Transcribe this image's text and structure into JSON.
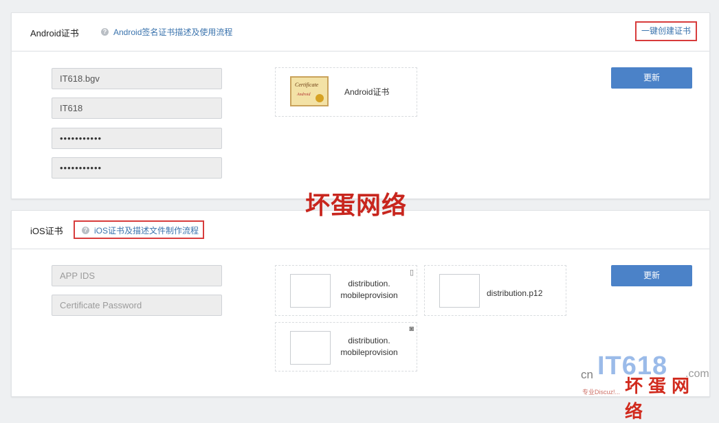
{
  "android": {
    "title": "Android证书",
    "help_link": "Android签名证书描述及使用流程",
    "create_link": "一键创建证书",
    "fields": [
      "IT618.bgv",
      "IT618",
      "•••••••••••",
      "•••••••••••"
    ],
    "cert_label": "Android证书",
    "update": "更新"
  },
  "ios": {
    "title": "iOS证书",
    "help_link": "iOS证书及描述文件制作流程",
    "placeholders": [
      "APP IDS",
      "Certificate Password"
    ],
    "tiles": [
      {
        "label": "distribution.\nmobileprovision",
        "icon": "phone-icon"
      },
      {
        "label": "distribution.p12",
        "icon": ""
      },
      {
        "label": "distribution.\nmobileprovision",
        "icon": "device-icon"
      }
    ],
    "update": "更新"
  },
  "overlay": "坏蛋网络",
  "watermark": {
    "cn": "cn",
    "brand": "IT618",
    "dotcom": ".com",
    "red": "坏蛋网络",
    "small": "专业Discuz!..."
  }
}
